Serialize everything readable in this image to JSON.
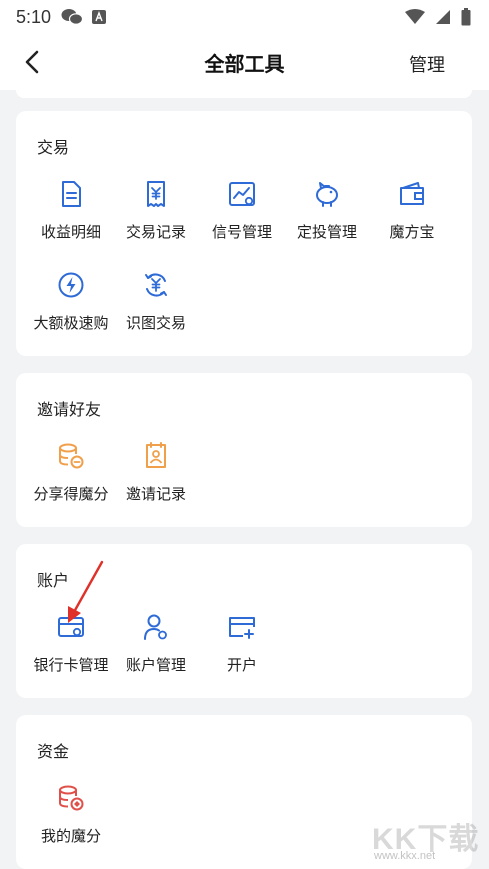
{
  "status_bar": {
    "time": "5:10"
  },
  "header": {
    "title": "全部工具",
    "manage_label": "管理"
  },
  "colors": {
    "blue_icon": "#2f6bd6",
    "orange_icon": "#f0a04b",
    "red_icon": "#e0504a",
    "arrow": "#e0302a"
  },
  "sections": {
    "trade": {
      "title": "交易",
      "items": [
        {
          "label": "收益明细",
          "icon": "document-icon"
        },
        {
          "label": "交易记录",
          "icon": "yen-receipt-icon"
        },
        {
          "label": "信号管理",
          "icon": "chart-settings-icon"
        },
        {
          "label": "定投管理",
          "icon": "piggy-bank-icon"
        },
        {
          "label": "魔方宝",
          "icon": "wallet-icon"
        },
        {
          "label": "大额极速购",
          "icon": "lightning-icon"
        },
        {
          "label": "识图交易",
          "icon": "yen-exchange-icon"
        }
      ]
    },
    "invite": {
      "title": "邀请好友",
      "items": [
        {
          "label": "分享得魔分",
          "icon": "coins-share-icon"
        },
        {
          "label": "邀请记录",
          "icon": "invite-record-icon"
        }
      ]
    },
    "account": {
      "title": "账户",
      "items": [
        {
          "label": "银行卡管理",
          "icon": "bank-card-settings-icon"
        },
        {
          "label": "账户管理",
          "icon": "user-settings-icon"
        },
        {
          "label": "开户",
          "icon": "card-add-icon"
        }
      ]
    },
    "funds": {
      "title": "资金",
      "items": [
        {
          "label": "我的魔分",
          "icon": "coins-points-icon"
        }
      ]
    }
  },
  "watermark": {
    "text": "KK下载",
    "url": "www.kkx.net"
  }
}
